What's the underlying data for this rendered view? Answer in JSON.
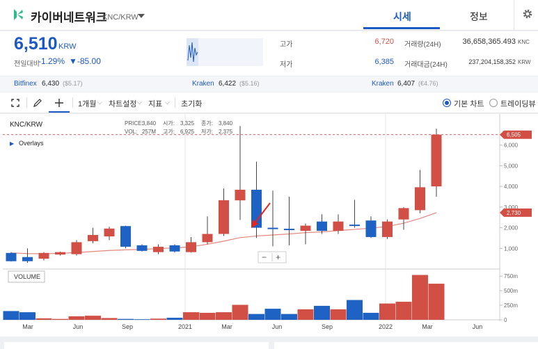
{
  "header": {
    "title": "카이버네트워크",
    "pair": "KNC/KRW",
    "tabs": [
      {
        "label": "시세"
      },
      {
        "label": "정보"
      }
    ]
  },
  "summary": {
    "price": "6,510",
    "unit": "KRW",
    "change_label": "전일대비",
    "change_pct": "-1.29%",
    "change_abs": "▼-85.00",
    "high_label": "고가",
    "high_val": "6,720",
    "low_label": "저가",
    "low_val": "6,385",
    "vol_label": "거래량(24H)",
    "vol_val": "36,658,365.493",
    "vol_unit": "KNC",
    "amt_label": "거래대금(24H)",
    "amt_val": "237,204,158,352",
    "amt_unit": "KRW"
  },
  "exchanges": [
    {
      "name": "Bitfinex",
      "price": "6,430",
      "sub": "($5.17)"
    },
    {
      "name": "Kraken",
      "price": "6,422",
      "sub": "($5.16)"
    },
    {
      "name": "Kraken",
      "price": "6,407",
      "sub": "(€4.76)"
    }
  ],
  "toolbar": {
    "period": "1개월",
    "settings": "차트설정",
    "indicator": "지표",
    "reset": "초기화",
    "basic": "기본 차트",
    "tradingview": "트레이딩뷰"
  },
  "colors": {
    "up": "#d24f45",
    "down": "#1e62c4",
    "accent": "#1c59c4",
    "logo": "#2dbb8b"
  },
  "chart_data": {
    "type": "candlestick",
    "pair_label": "KNC/KRW",
    "overlays_label": "Overlays",
    "info": {
      "price_label": "PRICE:",
      "price": "3,840",
      "open_label": "시가:",
      "open": "3,325",
      "close_label": "종가:",
      "close": "3,840",
      "vol_label": "VOL:",
      "vol": "257M",
      "high_label": "고가:",
      "high": "6,925",
      "low_label": "저가:",
      "low": "2,375"
    },
    "ylim": [
      0,
      7000
    ],
    "y_ticks": [
      "1,000",
      "2,000",
      "3,000",
      "4,000",
      "5,000",
      "6,000"
    ],
    "current_price": "6,505",
    "ma_price": "2,730",
    "volume_label": "VOLUME",
    "volume_ticks": [
      "0",
      "250m",
      "500m",
      "750m"
    ],
    "x_ticks": [
      "Mar",
      "Jun",
      "Sep",
      "2021",
      "Mar",
      "Jun",
      "Sep",
      "2022",
      "Mar",
      "Jun"
    ],
    "candles": [
      {
        "o": 780,
        "c": 380,
        "h": 820,
        "l": 360,
        "v": 150
      },
      {
        "o": 580,
        "c": 380,
        "h": 1000,
        "l": 300,
        "v": 130
      },
      {
        "o": 500,
        "c": 780,
        "h": 820,
        "l": 420,
        "v": 25
      },
      {
        "o": 700,
        "c": 820,
        "h": 840,
        "l": 650,
        "v": 15
      },
      {
        "o": 720,
        "c": 1300,
        "h": 1400,
        "l": 650,
        "v": 60
      },
      {
        "o": 1350,
        "c": 1650,
        "h": 2000,
        "l": 1250,
        "v": 70
      },
      {
        "o": 1580,
        "c": 1960,
        "h": 2050,
        "l": 1400,
        "v": 30
      },
      {
        "o": 2080,
        "c": 1080,
        "h": 2100,
        "l": 1000,
        "v": 15
      },
      {
        "o": 1150,
        "c": 880,
        "h": 1200,
        "l": 850,
        "v": 10
      },
      {
        "o": 820,
        "c": 1080,
        "h": 1200,
        "l": 720,
        "v": 20
      },
      {
        "o": 1150,
        "c": 850,
        "h": 1200,
        "l": 800,
        "v": 35
      },
      {
        "o": 820,
        "c": 1300,
        "h": 1550,
        "l": 800,
        "v": 130
      },
      {
        "o": 1300,
        "c": 1700,
        "h": 2550,
        "l": 1200,
        "v": 120
      },
      {
        "o": 1700,
        "c": 3330,
        "h": 3900,
        "l": 1600,
        "v": 130
      },
      {
        "o": 3325,
        "c": 3840,
        "h": 6925,
        "l": 2375,
        "v": 257
      },
      {
        "o": 3840,
        "c": 2000,
        "h": 5200,
        "l": 1500,
        "v": 100
      },
      {
        "o": 2000,
        "c": 1950,
        "h": 3800,
        "l": 1100,
        "v": 190
      },
      {
        "o": 1950,
        "c": 1920,
        "h": 3500,
        "l": 1150,
        "v": 100
      },
      {
        "o": 1850,
        "c": 2100,
        "h": 2200,
        "l": 1200,
        "v": 180
      },
      {
        "o": 2300,
        "c": 1850,
        "h": 2650,
        "l": 1700,
        "v": 240
      },
      {
        "o": 1850,
        "c": 2300,
        "h": 2650,
        "l": 1700,
        "v": 180
      },
      {
        "o": 2150,
        "c": 2100,
        "h": 3350,
        "l": 2000,
        "v": 340
      },
      {
        "o": 2350,
        "c": 1550,
        "h": 2550,
        "l": 1500,
        "v": 120
      },
      {
        "o": 1550,
        "c": 2300,
        "h": 2400,
        "l": 1450,
        "v": 280
      },
      {
        "o": 2400,
        "c": 2950,
        "h": 3000,
        "l": 1900,
        "v": 310
      },
      {
        "o": 2850,
        "c": 3960,
        "h": 4800,
        "l": 2700,
        "v": 770
      },
      {
        "o": 4000,
        "c": 6505,
        "h": 6800,
        "l": 3500,
        "v": 620
      }
    ],
    "ma": [
      780,
      750,
      740,
      760,
      800,
      850,
      900,
      930,
      950,
      990,
      1020,
      1080,
      1200,
      1350,
      1520,
      1600,
      1650,
      1700,
      1760,
      1800,
      1860,
      1920,
      1980,
      2060,
      2220,
      2450,
      2730
    ]
  }
}
